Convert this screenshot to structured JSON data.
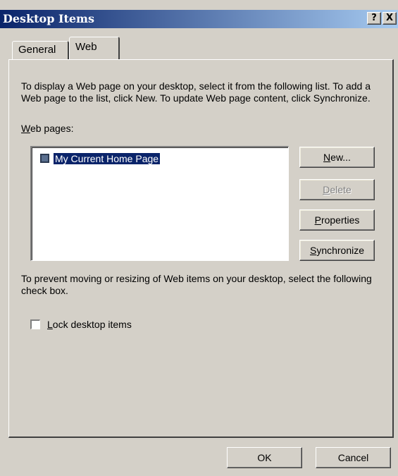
{
  "window": {
    "title": "Desktop Items",
    "help_label": "?",
    "close_label": "X"
  },
  "tabs": [
    {
      "label": "General",
      "active": false
    },
    {
      "label": "Web",
      "active": true
    }
  ],
  "web_tab": {
    "description": "To display a Web page on your desktop, select it from the following list. To add a Web page to the list, click New.  To update Web page content, click Synchronize.",
    "web_pages_label_prefix": "W",
    "web_pages_label_rest": "eb pages:",
    "list_items": [
      {
        "label": "My Current Home Page",
        "selected": true
      }
    ],
    "buttons": {
      "new": {
        "prefix": "N",
        "rest": "ew...",
        "enabled": true
      },
      "delete": {
        "prefix": "D",
        "rest": "elete",
        "enabled": false
      },
      "properties": {
        "prefix": "P",
        "rest": "roperties",
        "enabled": true
      },
      "synchronize": {
        "prefix": "S",
        "rest": "ynchronize",
        "enabled": true
      }
    },
    "lock_description": "To prevent moving or resizing of Web items on your desktop, select the following check box.",
    "lock_checkbox": {
      "prefix": "L",
      "rest": "ock desktop items",
      "checked": false
    }
  },
  "footer": {
    "ok_label": "OK",
    "cancel_label": "Cancel"
  },
  "colors": {
    "title_start": "#0a246a",
    "title_end": "#a6caf0",
    "face": "#d4d0c8",
    "selection": "#0a246a"
  }
}
